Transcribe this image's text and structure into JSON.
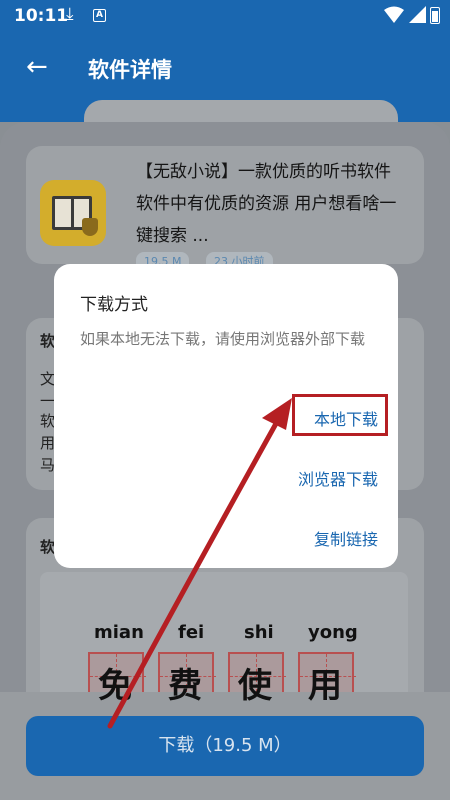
{
  "status_bar": {
    "time": "10:11",
    "download_glyph": "⤓",
    "notif_letter": "A"
  },
  "header": {
    "back_glyph": "←",
    "title": "软件详情"
  },
  "app": {
    "description": "【无敌小说】一款优质的听书软件 软件中有优质的资源 用户想看啥一键搜索 ...",
    "tags": [
      "19.5 M",
      "23 小时前"
    ],
    "icon": "book-shield-icon"
  },
  "hidden_preview": {
    "card2_lines": [
      "软",
      "文",
      "一",
      "软",
      "用",
      "马"
    ],
    "card3_label": "软",
    "pinyin": [
      "mian",
      "fei",
      "shi",
      "yong"
    ],
    "hanzi": [
      "免",
      "费",
      "使",
      "用"
    ]
  },
  "dialog": {
    "title": "下载方式",
    "message": "如果本地无法下载，请使用浏览器外部下载",
    "options": [
      "本地下载",
      "浏览器下载",
      "复制链接"
    ]
  },
  "download_button": {
    "label": "下载（19.5 M）"
  },
  "colors": {
    "brand": "#1a67b0",
    "highlight": "#b51f23",
    "arrow": "#b51f23"
  }
}
